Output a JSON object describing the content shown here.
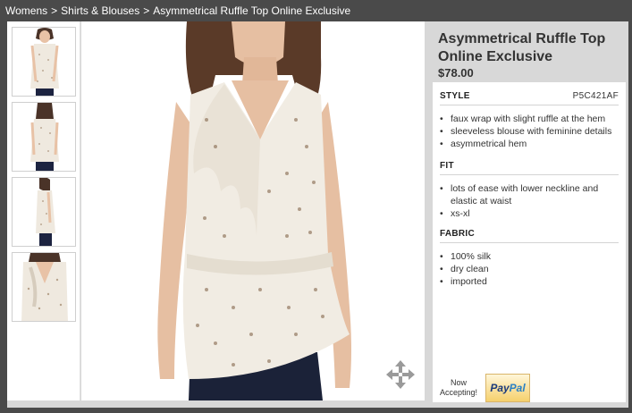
{
  "breadcrumb": {
    "items": [
      "Womens",
      "Shirts & Blouses",
      "Asymmetrical Ruffle Top Online Exclusive"
    ],
    "separator": ">"
  },
  "product": {
    "title": "Asymmetrical Ruffle Top Online Exclusive",
    "price": "$78.00"
  },
  "sections": {
    "style": {
      "heading": "STYLE",
      "code": "P5C421AF",
      "bullets": [
        "faux wrap with slight ruffle at the hem",
        "sleeveless blouse with feminine details",
        "asymmetrical hem"
      ]
    },
    "fit": {
      "heading": "FIT",
      "bullets": [
        "lots of ease with lower neckline and elastic at waist",
        "xs-xl"
      ]
    },
    "fabric": {
      "heading": "FABRIC",
      "bullets": [
        "100% silk",
        "dry clean",
        "imported"
      ]
    }
  },
  "payment": {
    "now_accepting": "Now Accepting!",
    "paypal_pay": "Pay",
    "paypal_pal": "Pal"
  },
  "colors": {
    "top_bar": "#4a4a4a",
    "panel_bg": "#d8d8d8",
    "text": "#333333"
  },
  "icons": [
    "zoom-move-icon",
    "paypal-logo"
  ]
}
